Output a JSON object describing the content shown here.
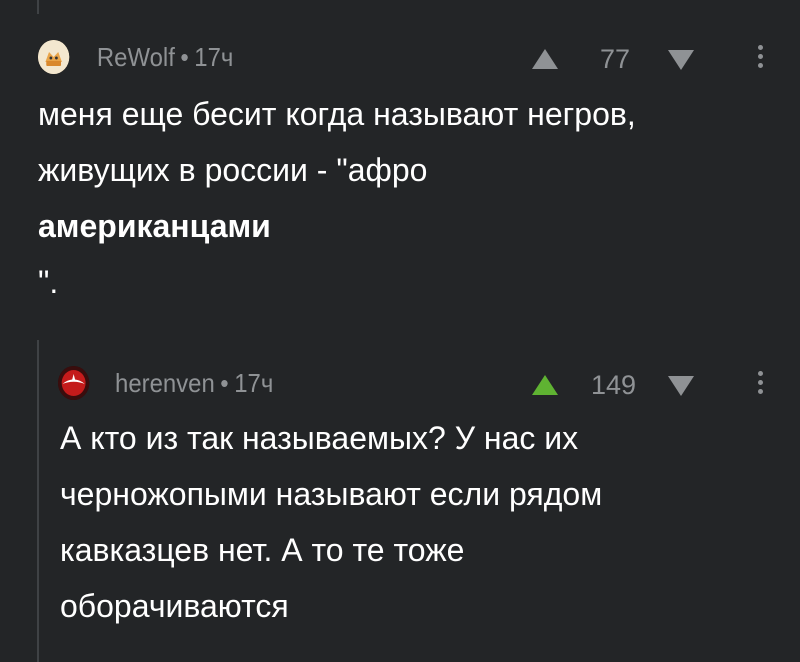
{
  "comments": [
    {
      "username": "ReWolf",
      "separator": "•",
      "time": "17ч",
      "score": "77",
      "upvoted": false,
      "text_line1": "меня еще бесит когда называют негров,",
      "text_line2": "живущих в россии - \"афро",
      "text_bold": "американцами",
      "text_line4": "\"."
    },
    {
      "username": "herenven",
      "separator": "•",
      "time": "17ч",
      "score": "149",
      "upvoted": true,
      "text_line1": "А кто из так называемых? У нас их",
      "text_line2": "черножопыми называют если рядом",
      "text_line3": "кавказцев нет. А то те тоже",
      "text_line4": "оборачиваются"
    }
  ],
  "colors": {
    "background": "#232527",
    "muted": "#8f9295",
    "upvote_active": "#5fb332",
    "thread_line": "#3f4245",
    "text": "#ffffff"
  },
  "icons": {
    "vote_up": "arrow-up-icon",
    "vote_down": "arrow-down-icon",
    "more": "more-vertical-icon"
  }
}
